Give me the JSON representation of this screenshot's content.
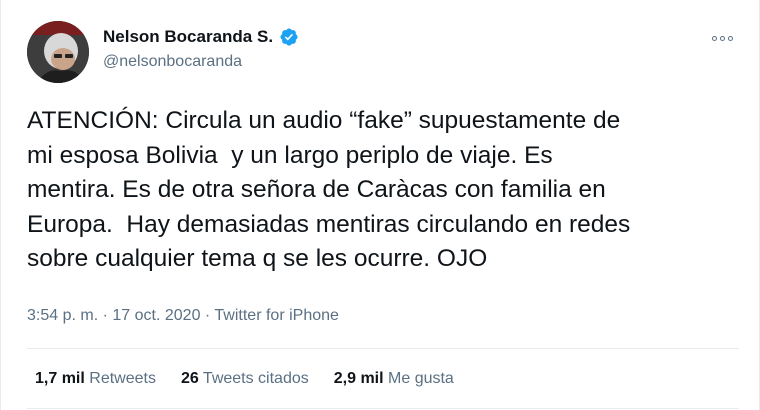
{
  "author": {
    "name": "Nelson Bocaranda S.",
    "handle": "@nelsonbocaranda",
    "verified": true,
    "avatar_icon": "profile-photo"
  },
  "tweet": {
    "text": "ATENCIÓN: Circula un audio “fake” supuestamente de\nmi esposa Bolivia  y un largo periplo de viaje. Es\nmentira. Es de otra señora de Caràcas con familia en\nEuropa.  Hay demasiadas mentiras circulando en redes\nsobre cualquier tema q se les ocurre. OJO",
    "time": "3:54 p. m.",
    "separator": "·",
    "date": "17 oct. 2020",
    "source": "Twitter for iPhone"
  },
  "stats": [
    {
      "count": "1,7 mil",
      "label": "Retweets"
    },
    {
      "count": "26",
      "label": "Tweets citados"
    },
    {
      "count": "2,9 mil",
      "label": "Me gusta"
    }
  ],
  "colors": {
    "verified": "#1da1f2",
    "secondary_text": "#5b7083",
    "divider": "#e6ecf0"
  }
}
